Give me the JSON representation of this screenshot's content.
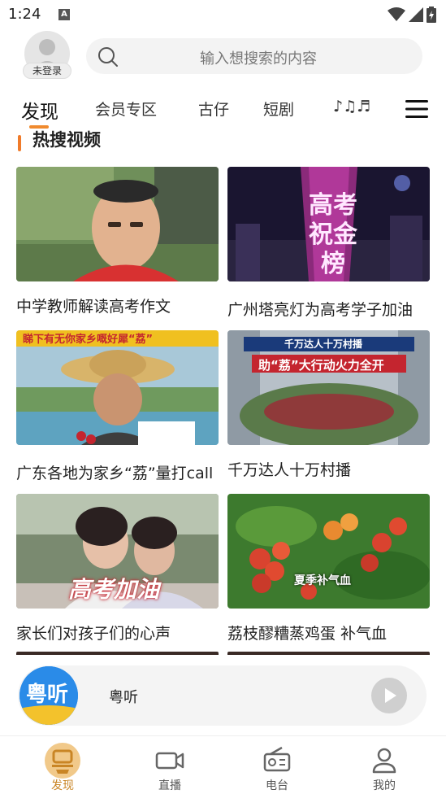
{
  "status_bar": {
    "time": "1:24",
    "notification_letter": "A"
  },
  "header": {
    "login_label": "未登录",
    "search_placeholder": "输入想搜索的内容"
  },
  "tabs": [
    {
      "label": "发现",
      "active": true
    },
    {
      "label": "会员专区",
      "active": false
    },
    {
      "label": "古仔",
      "active": false
    },
    {
      "label": "短剧",
      "active": false
    },
    {
      "label": "♪♫♬",
      "active": false
    }
  ],
  "section": {
    "title": "热搜视频"
  },
  "videos": [
    {
      "title": "中学教师解读高考作文",
      "overlay": ""
    },
    {
      "title": "广州塔亮灯为高考学子加油",
      "overlay": "高考 祝金榜"
    },
    {
      "title": "广东各地为家乡“荔”量打call",
      "overlay": "睇下有无你家乡嘅好犀“荔”"
    },
    {
      "title": "千万达人十万村播",
      "overlay": "千万达人十万村播",
      "overlay2": "助“荔”大行动火力全开"
    },
    {
      "title": "家长们对孩子们的心声",
      "overlay": "高考加油"
    },
    {
      "title": "荔枝醪糟蒸鸡蛋  补气血",
      "overlay": "夏季补气血"
    }
  ],
  "player": {
    "name": "粤听",
    "logo_text": "粤听"
  },
  "bottom_nav": [
    {
      "label": "发现",
      "icon": "yue-logo-icon",
      "active": true
    },
    {
      "label": "直播",
      "icon": "video-camera-icon",
      "active": false
    },
    {
      "label": "电台",
      "icon": "radio-icon",
      "active": false
    },
    {
      "label": "我的",
      "icon": "user-icon",
      "active": false
    }
  ],
  "colors": {
    "accent": "#f08a2e",
    "active_nav": "#c98525",
    "player_blue": "#2a8be8"
  }
}
